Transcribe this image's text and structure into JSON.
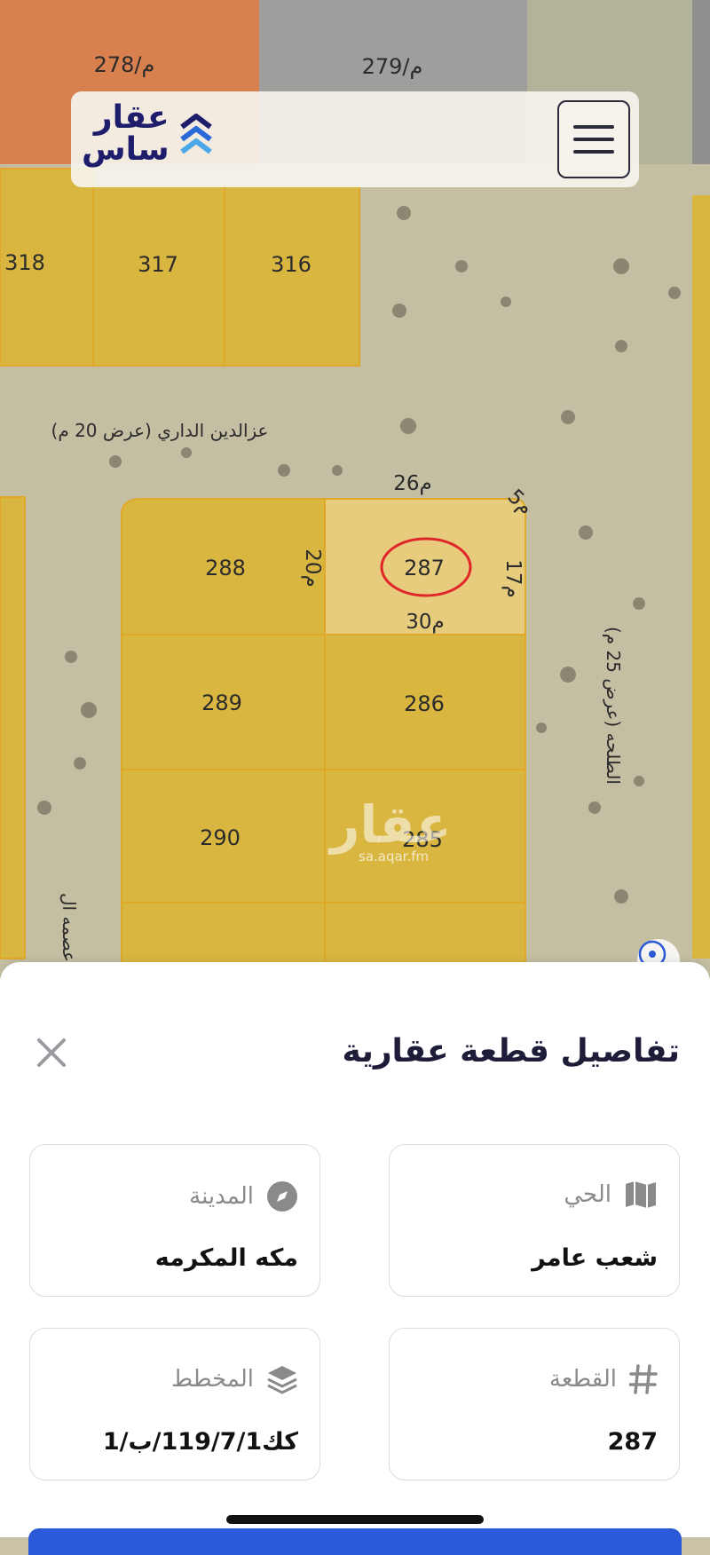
{
  "header": {
    "logo_line1": "عقار",
    "logo_line2": "ساس"
  },
  "map": {
    "plots": [
      {
        "id": "p278",
        "label": "278/م"
      },
      {
        "id": "p279",
        "label": "279/م"
      },
      {
        "id": "p318",
        "label": "318"
      },
      {
        "id": "p317",
        "label": "317"
      },
      {
        "id": "p316",
        "label": "316"
      },
      {
        "id": "p288",
        "label": "288"
      },
      {
        "id": "p287",
        "label": "287"
      },
      {
        "id": "p289",
        "label": "289"
      },
      {
        "id": "p286",
        "label": "286"
      },
      {
        "id": "p290",
        "label": "290"
      },
      {
        "id": "p285",
        "label": "285"
      }
    ],
    "dimensions": {
      "north": "26م",
      "corner": "5م",
      "west": "20م",
      "east": "17م",
      "south": "30م"
    },
    "streets": {
      "north": "عزالدين الداري (عرض 20 م)",
      "east": "الطلحه (عرض 25 م)",
      "west": "عصمه ال"
    },
    "watermark": {
      "logo": "عقار",
      "url": "sa.aqar.fm"
    },
    "colors": {
      "plot": "#d9b640",
      "selected_plot": "#e6cc7c",
      "ground": "#c4bea3",
      "highlight_circle": "#e0262a"
    }
  },
  "sheet": {
    "title": "تفاصيل قطعة عقارية",
    "cards": {
      "district": {
        "label": "الحي",
        "value": "شعب عامر"
      },
      "city": {
        "label": "المدينة",
        "value": "مكه المكرمه"
      },
      "plot": {
        "label": "القطعة",
        "value": "287"
      },
      "plan": {
        "label": "المخطط",
        "value": "كك119/7/1/ب/1"
      }
    }
  }
}
